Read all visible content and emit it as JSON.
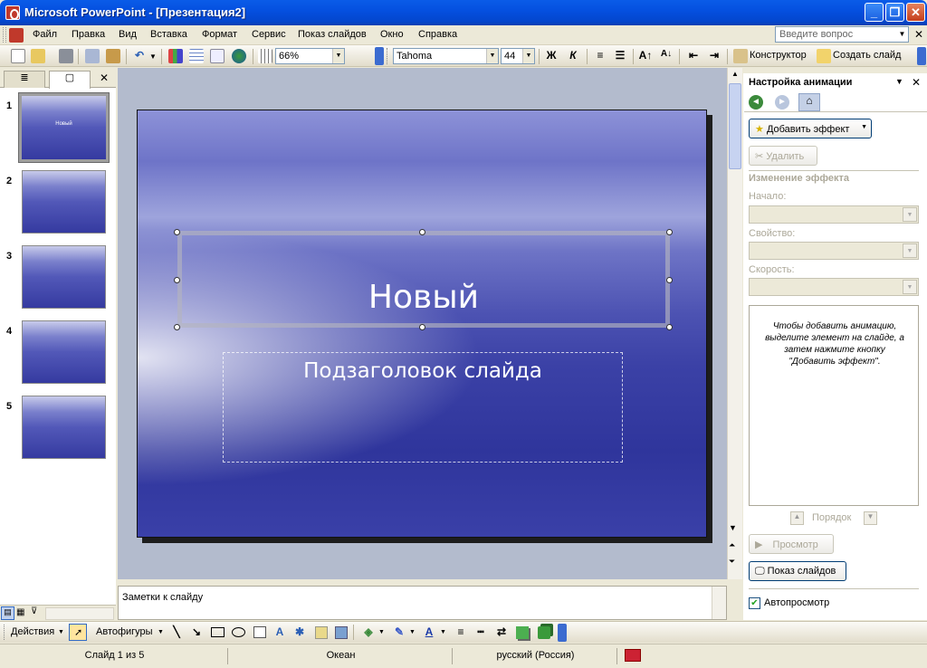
{
  "window": {
    "title": "Microsoft PowerPoint - [Презентация2]"
  },
  "menu": [
    "Файл",
    "Правка",
    "Вид",
    "Вставка",
    "Формат",
    "Сервис",
    "Показ слайдов",
    "Окно",
    "Справка"
  ],
  "ask_placeholder": "Введите вопрос",
  "toolbar": {
    "zoom": "66%",
    "font": "Tahoma",
    "size": "44",
    "bold": "Ж",
    "italic": "К",
    "designer": "Конструктор",
    "new_slide": "Создать слайд"
  },
  "thumbnails": [
    {
      "num": "1",
      "text": "Новый"
    },
    {
      "num": "2",
      "text": ""
    },
    {
      "num": "3",
      "text": ""
    },
    {
      "num": "4",
      "text": ""
    },
    {
      "num": "5",
      "text": ""
    }
  ],
  "slide": {
    "title": "Новый",
    "subtitle": "Подзаголовок слайда"
  },
  "notes": "Заметки к слайду",
  "task_pane": {
    "title": "Настройка анимации",
    "add_effect": "Добавить эффект",
    "remove": "Удалить",
    "section": "Изменение эффекта",
    "start_label": "Начало:",
    "property_label": "Свойство:",
    "speed_label": "Скорость:",
    "hint": "Чтобы добавить анимацию, выделите элемент на слайде, а затем нажмите кнопку \"Добавить эффект\".",
    "order": "Порядок",
    "preview": "Просмотр",
    "slideshow": "Показ слайдов",
    "autopreview": "Автопросмотр",
    "autopreview_checked": true
  },
  "drawing": {
    "actions": "Действия",
    "autoshapes": "Автофигуры"
  },
  "status": {
    "slide": "Слайд 1 из 5",
    "design": "Океан",
    "language": "русский (Россия)"
  }
}
